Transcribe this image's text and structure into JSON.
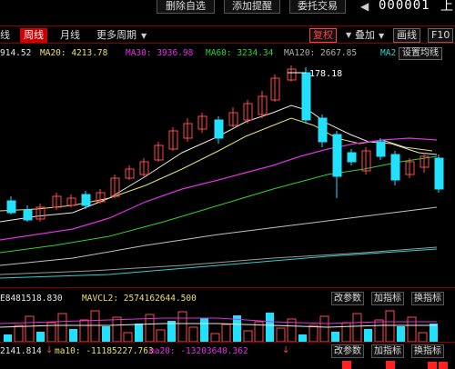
{
  "toolbar": {
    "btn1": "删除自选",
    "btn2": "添加提醒",
    "btn3": "委托交易",
    "code": "000001",
    "title_partial": "上"
  },
  "periods": {
    "prev": "线",
    "week": "周线",
    "month": "月线",
    "more": "更多周期"
  },
  "actions": {
    "fuquan": "复权",
    "overlay": "叠加",
    "draw": "画线",
    "f10": "F10"
  },
  "legend": {
    "ma10": "914.52",
    "ma20": "MA20: 4213.78",
    "ma30": "MA30: 3936.98",
    "ma60": "MA60: 3234.34",
    "ma120": "MA120: 2667.85",
    "ma2": "MA2",
    "set_ma": "设置均线"
  },
  "chart": {
    "high_label": "178.18"
  },
  "indicator1": {
    "left": "E8481518.830",
    "mavcl": "MAVCL2: 2574162644.500",
    "btn_param": "改参数",
    "btn_add": "加指标",
    "btn_switch": "换指标"
  },
  "indicator2": {
    "left": "2141.814",
    "ma10": "ma10: -11185227.763",
    "ma20": "ma20: -13203640.362",
    "btn_param": "改参数",
    "btn_add": "加指标",
    "btn_switch": "换指标"
  },
  "colors": {
    "up": "#ff4a4a",
    "down": "#22e1ff",
    "ma_white": "#e8e8e8",
    "ma_yellow": "#e8e070",
    "ma_magenta": "#e030e0",
    "ma_green": "#30d030",
    "ma_gray": "#b0b0b0"
  },
  "icons": [
    "left-arrow-icon",
    "right-arrow-icon",
    "dropdown-icon",
    "down-arrow-icon"
  ]
}
